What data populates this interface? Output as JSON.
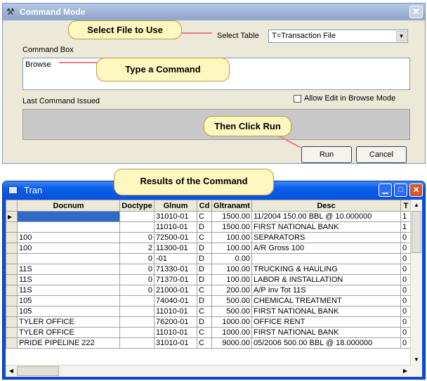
{
  "dialog": {
    "title": "Command Mode",
    "close_glyph": "✕",
    "title_icon": "tools-icon",
    "select_table_label": "Select Table",
    "select_table_value": "T=Transaction File",
    "command_box_label": "Command Box",
    "command_value": "Browse",
    "last_command_label": "Last Command Issued",
    "allow_edit_label": "Allow Edit in Browse Mode",
    "allow_edit_checked": false,
    "run_label": "Run",
    "cancel_label": "Cancel"
  },
  "callouts": {
    "select_file": "Select File to Use",
    "type_command": "Type a Command",
    "then_click_run": "Then Click Run",
    "results": "Results of the Command"
  },
  "colors": {
    "callout_fill": "#fff7c0",
    "callout_line": "#ef7b8a",
    "title_blue": "#0a5ee8",
    "selection": "#3169c6"
  },
  "tran": {
    "title": "Tran",
    "columns": [
      "Docnum",
      "Doctype",
      "Glnum",
      "Cd",
      "Gltranamt",
      "Desc",
      "T"
    ],
    "rows": [
      [
        "",
        "",
        "31010-01",
        "C",
        "1500.00",
        "11/2004 150.00 BBL @ 10.000000",
        "1"
      ],
      [
        "",
        "",
        "11010-01",
        "D",
        "1500.00",
        "FIRST NATIONAL BANK",
        "1"
      ],
      [
        "100",
        "0",
        "72500-01",
        "C",
        "100.00",
        "SEPARATORS",
        "0"
      ],
      [
        "100",
        "2",
        "11300-01",
        "D",
        "100.00",
        "A/R Gross 100",
        "0"
      ],
      [
        "",
        "0",
        "-01",
        "D",
        "0.00",
        "",
        "0"
      ],
      [
        "11S",
        "0",
        "71330-01",
        "D",
        "100.00",
        "TRUCKING & HAULING",
        "0"
      ],
      [
        "11S",
        "0",
        "71370-01",
        "D",
        "100.00",
        "LABOR & INSTALLATION",
        "0"
      ],
      [
        "11S",
        "0",
        "21000-01",
        "C",
        "200.00",
        "A/P Inv Tot 11S",
        "0"
      ],
      [
        "105",
        "",
        "74040-01",
        "D",
        "500.00",
        "CHEMICAL TREATMENT",
        "0"
      ],
      [
        "105",
        "",
        "11010-01",
        "C",
        "500.00",
        "FIRST NATIONAL BANK",
        "0"
      ],
      [
        "TYLER OFFICE",
        "",
        "76200-01",
        "D",
        "1000.00",
        "OFFICE RENT",
        "0"
      ],
      [
        "TYLER OFFICE",
        "",
        "11010-01",
        "C",
        "1000.00",
        "FIRST NATIONAL BANK",
        "0"
      ],
      [
        "PRIDE PIPELINE 222",
        "",
        "31010-01",
        "C",
        "9000.00",
        "05/2006 500.00 BBL @ 18.000000",
        "0"
      ]
    ]
  }
}
